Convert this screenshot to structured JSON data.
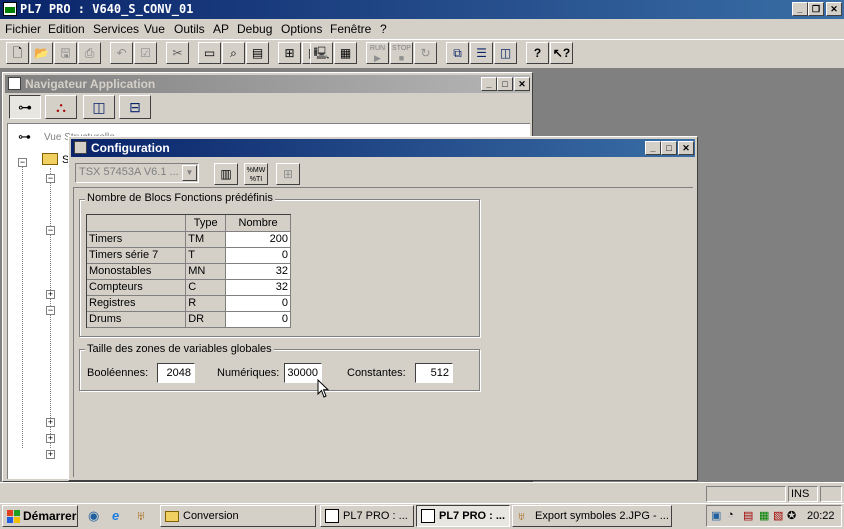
{
  "main_title": "PL7 PRO : V640_S_CONV_01",
  "menu": [
    "Fichier",
    "Edition",
    "Services",
    "Vue",
    "Outils",
    "AP",
    "Debug",
    "Options",
    "Fenêtre",
    "?"
  ],
  "toolbar_run": "RUN",
  "toolbar_stop": "STOP",
  "navigator": {
    "title": "Navigateur Application",
    "tree_root": "Vue Structurelle",
    "tree_first_item": "S"
  },
  "config": {
    "title": "Configuration",
    "processor_select": "TSX 57453A  V6.1 ...",
    "group1_label": "Nombre de Blocs Fonctions prédéfinis",
    "columns": [
      "",
      "Type",
      "Nombre"
    ],
    "rows": [
      {
        "name": "Timers",
        "type": "TM",
        "count": "200"
      },
      {
        "name": "Timers série 7",
        "type": "T",
        "count": "0"
      },
      {
        "name": "Monostables",
        "type": "MN",
        "count": "32"
      },
      {
        "name": "Compteurs",
        "type": "C",
        "count": "32"
      },
      {
        "name": "Registres",
        "type": "R",
        "count": "0"
      },
      {
        "name": "Drums",
        "type": "DR",
        "count": "0"
      }
    ],
    "group2_label": "Taille des zones de variables globales",
    "bool_label": "Booléennes:",
    "bool_value": "2048",
    "num_label": "Numériques:",
    "num_value": "30000",
    "const_label": "Constantes:",
    "const_value": "512"
  },
  "statusbar": {
    "ins": "INS"
  },
  "taskbar": {
    "start": "Démarrer",
    "tasks": [
      "Conversion",
      "PL7 PRO : ...",
      "PL7 PRO : ...",
      "Export symboles 2.JPG - ..."
    ],
    "clock": "20:22"
  }
}
